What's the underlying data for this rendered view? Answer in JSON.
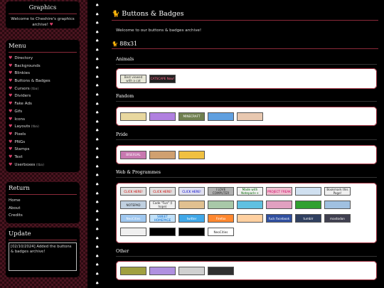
{
  "sidebar": {
    "graphics_title": "Graphics",
    "welcome_text": "Welcome to Cheshire's graphics archive!",
    "welcome_heart": "♥",
    "menu_title": "Menu",
    "menu_items": [
      {
        "label": "Directory",
        "note": ""
      },
      {
        "label": "Backgrounds",
        "note": ""
      },
      {
        "label": "Blinkies",
        "note": ""
      },
      {
        "label": "Buttons & Badges",
        "note": ""
      },
      {
        "label": "Cursors",
        "note": "(tba)"
      },
      {
        "label": "Dividers",
        "note": ""
      },
      {
        "label": "Fake Ads",
        "note": ""
      },
      {
        "label": "Gifs",
        "note": ""
      },
      {
        "label": "Icons",
        "note": ""
      },
      {
        "label": "Layouts",
        "note": "(tba)"
      },
      {
        "label": "Pixels",
        "note": ""
      },
      {
        "label": "PNGs",
        "note": ""
      },
      {
        "label": "Stamps",
        "note": ""
      },
      {
        "label": "Text",
        "note": ""
      },
      {
        "label": "Userboxes",
        "note": "(tba)"
      }
    ],
    "return_title": "Return",
    "return_items": [
      "Home",
      "About",
      "Credits"
    ],
    "update_title": "Update",
    "update_text": "[02/10/2024] Added the buttons & badges archive!"
  },
  "main": {
    "title": "Buttons & Badges",
    "welcome": "Welcome to our buttons & badges archive!",
    "subtitle": "88x31",
    "sections": [
      {
        "label": "Animals",
        "buttons": [
          {
            "text": "Best viewed with a cat",
            "bg": "#e8e8d8",
            "fg": "#333"
          },
          {
            "text": "CATSCAPE Now!",
            "bg": "#222222",
            "fg": "#ff6688"
          }
        ]
      },
      {
        "label": "Fandom",
        "buttons": [
          {
            "text": "",
            "bg": "#e8d8a0",
            "fg": "#333"
          },
          {
            "text": "",
            "bg": "#b080e0",
            "fg": "#fff"
          },
          {
            "text": "MINECRAFT",
            "bg": "#708050",
            "fg": "#fff"
          },
          {
            "text": "",
            "bg": "#60a0e0",
            "fg": "#fff"
          },
          {
            "text": "",
            "bg": "#e8c8b0",
            "fg": "#333"
          }
        ]
      },
      {
        "label": "Pride",
        "buttons": [
          {
            "text": "BISEXUAL",
            "bg": "#c878b0",
            "fg": "#fff"
          },
          {
            "text": "",
            "bg": "#d0a070",
            "fg": "#333"
          },
          {
            "text": "",
            "bg": "#f0c040",
            "fg": "#333"
          }
        ]
      },
      {
        "label": "Web & Programmes",
        "buttons": [
          {
            "text": "CLICK HERE!",
            "bg": "#e0e0e0",
            "fg": "#c00"
          },
          {
            "text": "CLICK HERE!",
            "bg": "#e0e0e0",
            "fg": "#c00"
          },
          {
            "text": "CLICK HERE!",
            "bg": "#e0e0f0",
            "fg": "#00c"
          },
          {
            "text": "I LOVE COMPUTER",
            "bg": "#b0b0b0",
            "fg": "#222"
          },
          {
            "text": "Made with Notepad++",
            "bg": "#f0f0f0",
            "fg": "#060"
          },
          {
            "text": "PROJECT FREAK",
            "bg": "#f0c0d0",
            "fg": "#c06"
          },
          {
            "text": "",
            "bg": "#d0e0f0",
            "fg": "#222"
          },
          {
            "text": "Bookmark this Page!",
            "bg": "#f0f0f0",
            "fg": "#222"
          },
          {
            "text": "NOTEPAD",
            "bg": "#c0d0e0",
            "fg": "#222"
          },
          {
            "text": "Code \"Fun\" (I hope)",
            "bg": "#f0f0f0",
            "fg": "#222"
          },
          {
            "text": "",
            "bg": "#e0c090",
            "fg": "#333"
          },
          {
            "text": "",
            "bg": "#a8c8a8",
            "fg": "#222"
          },
          {
            "text": "",
            "bg": "#60c0e0",
            "fg": "#fff"
          },
          {
            "text": "",
            "bg": "#e0a0c0",
            "fg": "#222"
          },
          {
            "text": "",
            "bg": "#30a030",
            "fg": "#fff"
          },
          {
            "text": "",
            "bg": "#a0c0e0",
            "fg": "#222"
          },
          {
            "text": "NeoCities",
            "bg": "#a0c8f0",
            "fg": "#fff"
          },
          {
            "text": "SWEET HOMEPAGE",
            "bg": "#c0e0f8",
            "fg": "#06c"
          },
          {
            "text": "twitter",
            "bg": "#40a8e8",
            "fg": "#fff"
          },
          {
            "text": "Firefox",
            "bg": "#ff8830",
            "fg": "#fff"
          },
          {
            "text": "",
            "bg": "#ffd0a0",
            "fg": "#333"
          },
          {
            "text": "fuck facebook",
            "bg": "#3050a0",
            "fg": "#fff"
          },
          {
            "text": "tumblr",
            "bg": "#304060",
            "fg": "#fff"
          },
          {
            "text": "mastodon",
            "bg": "#404050",
            "fg": "#fff"
          },
          {
            "text": "",
            "bg": "#f0f0f0",
            "fg": "#222"
          },
          {
            "text": "",
            "bg": "#000000",
            "fg": "#fff"
          },
          {
            "text": "",
            "bg": "#000000",
            "fg": "#0f0"
          },
          {
            "text": "NeoCities",
            "bg": "#ffffff",
            "fg": "#222"
          }
        ]
      },
      {
        "label": "Other",
        "buttons": [
          {
            "text": "",
            "bg": "#a0a040",
            "fg": "#222"
          },
          {
            "text": "",
            "bg": "#b090e0",
            "fg": "#fff"
          },
          {
            "text": "",
            "bg": "#d0d0d0",
            "fg": "#222"
          },
          {
            "text": "",
            "bg": "#303030",
            "fg": "#fff"
          }
        ]
      }
    ]
  }
}
